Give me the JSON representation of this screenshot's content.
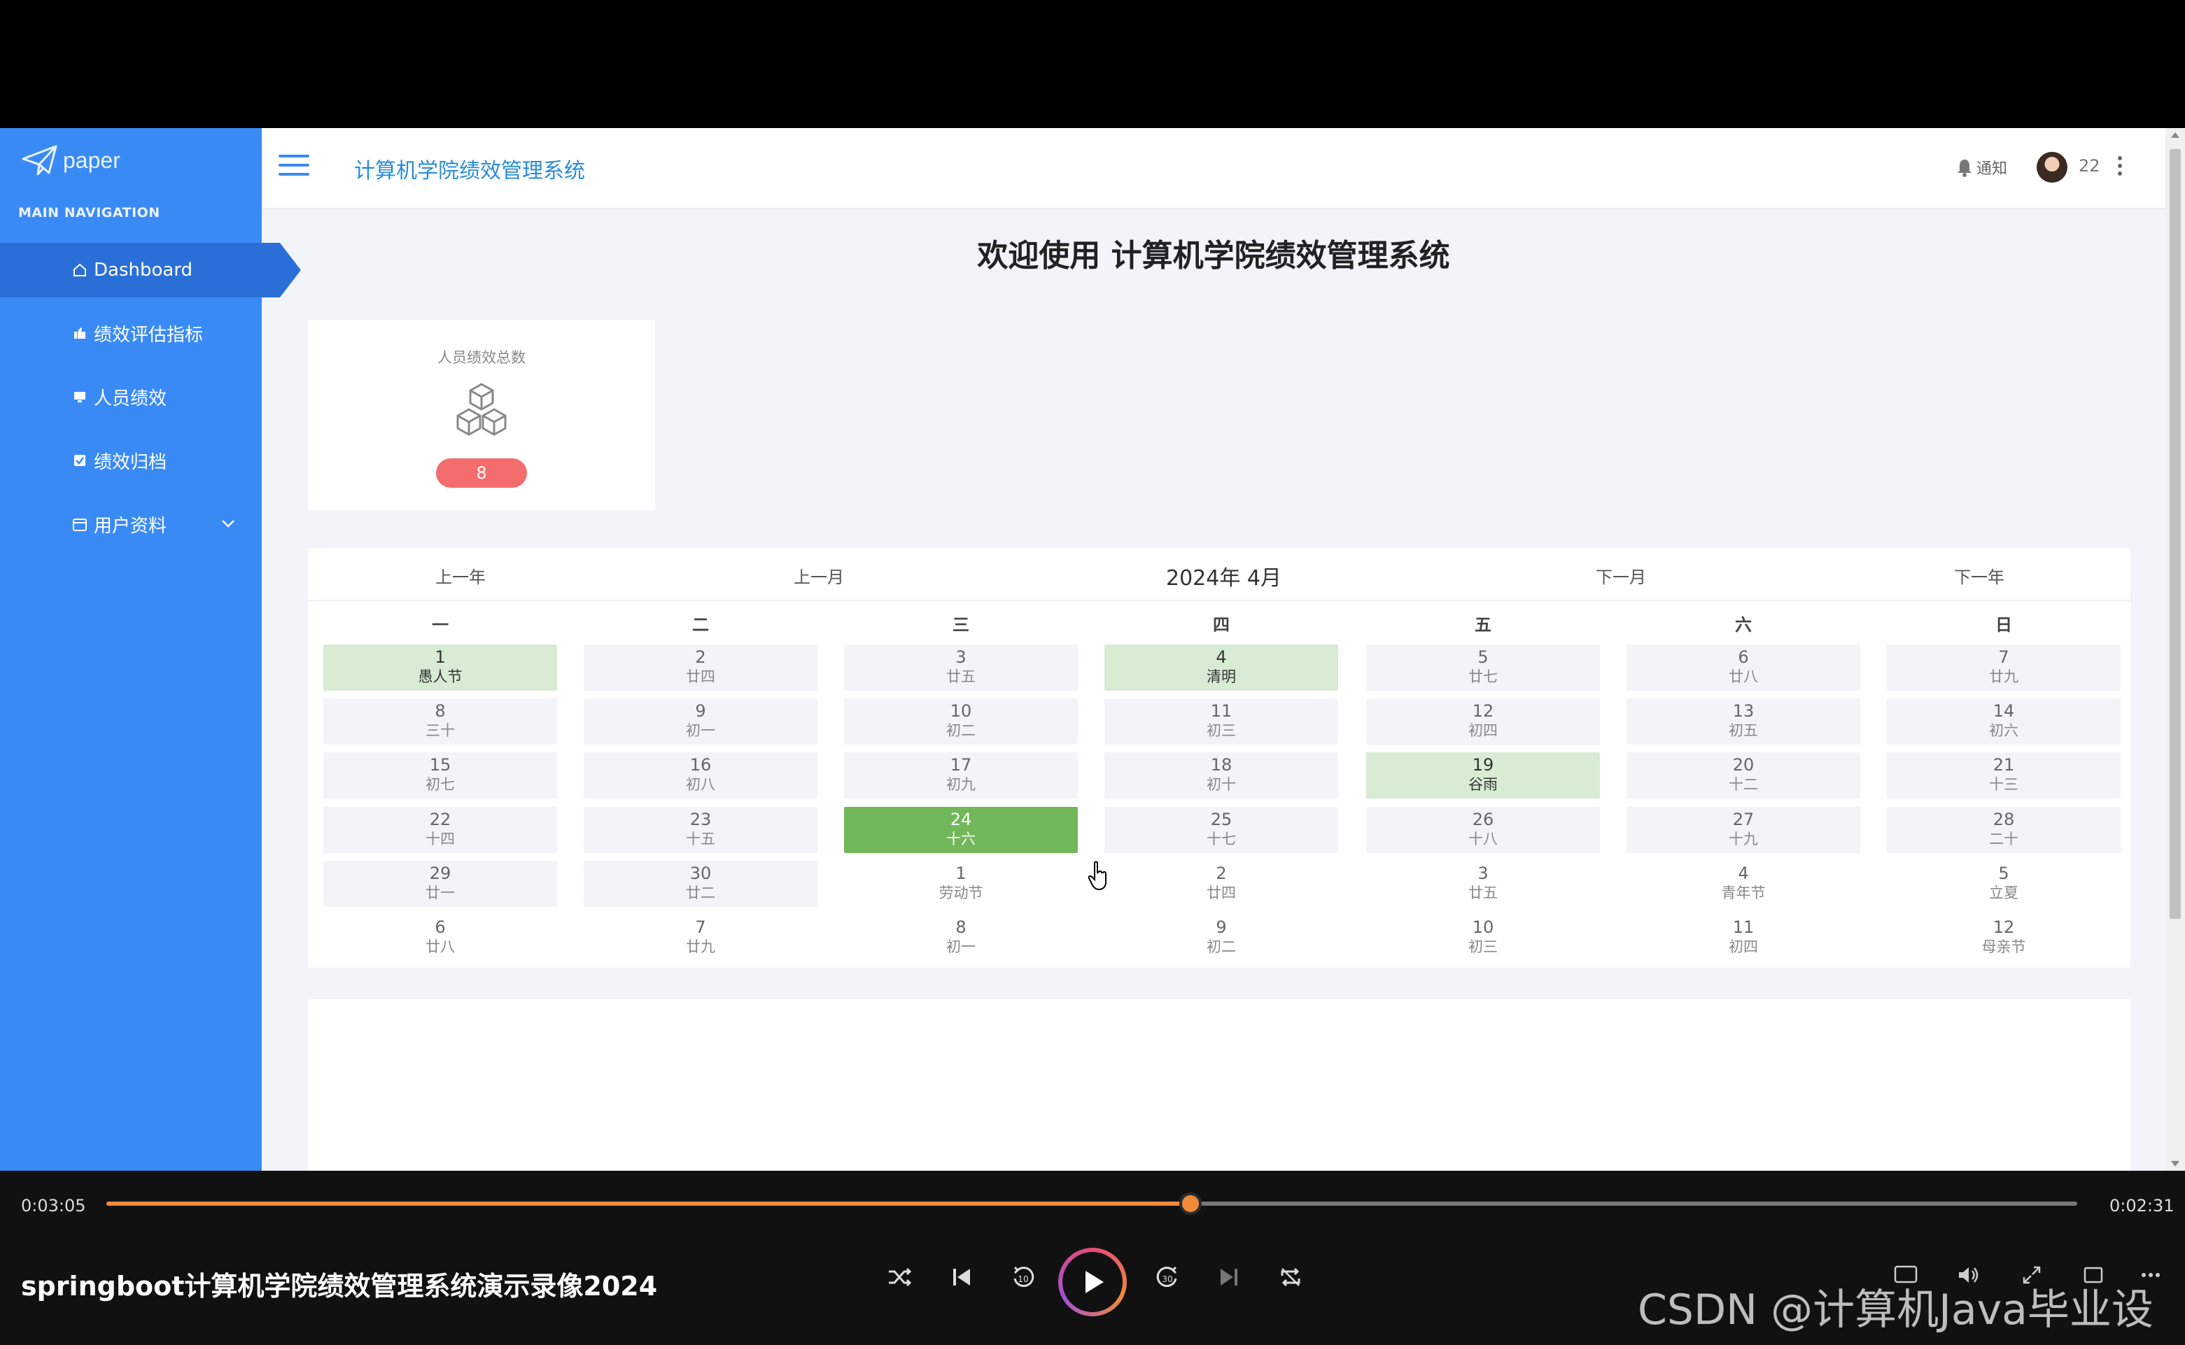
{
  "sidebar": {
    "logo_text": "paper",
    "caption": "MAIN NAVIGATION",
    "items": [
      {
        "label": "Dashboard"
      },
      {
        "label": "绩效评估指标"
      },
      {
        "label": "人员绩效"
      },
      {
        "label": "绩效归档"
      },
      {
        "label": "用户资料"
      }
    ]
  },
  "header": {
    "title": "计算机学院绩效管理系统",
    "notify_label": "通知",
    "user_label": "22"
  },
  "main": {
    "welcome": "欢迎使用 计算机学院绩效管理系统",
    "stat_card": {
      "label": "人员绩效总数",
      "value": "8"
    }
  },
  "calendar": {
    "prev_year": "上一年",
    "prev_month": "上一月",
    "month_title": "2024年 4月",
    "next_month": "下一月",
    "next_year": "下一年",
    "weekdays": [
      "一",
      "二",
      "三",
      "四",
      "五",
      "六",
      "日"
    ],
    "rows": [
      [
        {
          "d": "1",
          "l": "愚人节",
          "t": "holiday"
        },
        {
          "d": "2",
          "l": "廿四",
          "t": "in"
        },
        {
          "d": "3",
          "l": "廿五",
          "t": "in"
        },
        {
          "d": "4",
          "l": "清明",
          "t": "holiday"
        },
        {
          "d": "5",
          "l": "廿七",
          "t": "in"
        },
        {
          "d": "6",
          "l": "廿八",
          "t": "in"
        },
        {
          "d": "7",
          "l": "廿九",
          "t": "in"
        }
      ],
      [
        {
          "d": "8",
          "l": "三十",
          "t": "in"
        },
        {
          "d": "9",
          "l": "初一",
          "t": "in"
        },
        {
          "d": "10",
          "l": "初二",
          "t": "in"
        },
        {
          "d": "11",
          "l": "初三",
          "t": "in"
        },
        {
          "d": "12",
          "l": "初四",
          "t": "in"
        },
        {
          "d": "13",
          "l": "初五",
          "t": "in"
        },
        {
          "d": "14",
          "l": "初六",
          "t": "in"
        }
      ],
      [
        {
          "d": "15",
          "l": "初七",
          "t": "in"
        },
        {
          "d": "16",
          "l": "初八",
          "t": "in"
        },
        {
          "d": "17",
          "l": "初九",
          "t": "in"
        },
        {
          "d": "18",
          "l": "初十",
          "t": "in"
        },
        {
          "d": "19",
          "l": "谷雨",
          "t": "holiday"
        },
        {
          "d": "20",
          "l": "十二",
          "t": "in"
        },
        {
          "d": "21",
          "l": "十三",
          "t": "in"
        }
      ],
      [
        {
          "d": "22",
          "l": "十四",
          "t": "in"
        },
        {
          "d": "23",
          "l": "十五",
          "t": "in"
        },
        {
          "d": "24",
          "l": "十六",
          "t": "today"
        },
        {
          "d": "25",
          "l": "十七",
          "t": "in"
        },
        {
          "d": "26",
          "l": "十八",
          "t": "in"
        },
        {
          "d": "27",
          "l": "十九",
          "t": "in"
        },
        {
          "d": "28",
          "l": "二十",
          "t": "in"
        }
      ],
      [
        {
          "d": "29",
          "l": "廿一",
          "t": "in"
        },
        {
          "d": "30",
          "l": "廿二",
          "t": "in"
        },
        {
          "d": "1",
          "l": "劳动节",
          "t": "out"
        },
        {
          "d": "2",
          "l": "廿四",
          "t": "out"
        },
        {
          "d": "3",
          "l": "廿五",
          "t": "out"
        },
        {
          "d": "4",
          "l": "青年节",
          "t": "out"
        },
        {
          "d": "5",
          "l": "立夏",
          "t": "out"
        }
      ],
      [
        {
          "d": "6",
          "l": "廿八",
          "t": "out"
        },
        {
          "d": "7",
          "l": "廿九",
          "t": "out"
        },
        {
          "d": "8",
          "l": "初一",
          "t": "out"
        },
        {
          "d": "9",
          "l": "初二",
          "t": "out"
        },
        {
          "d": "10",
          "l": "初三",
          "t": "out"
        },
        {
          "d": "11",
          "l": "初四",
          "t": "out"
        },
        {
          "d": "12",
          "l": "母亲节",
          "t": "out"
        }
      ]
    ]
  },
  "player": {
    "elapsed": "0:03:05",
    "total": "0:02:31",
    "progress": 0.55,
    "title": "springboot计算机学院绩效管理系统演示录像2024",
    "rewind_label": "10",
    "forward_label": "30",
    "watermark": "CSDN @计算机Java毕业设计"
  },
  "colors": {
    "sidebar": "#3a8af6",
    "sidebar_active": "#2a6fd8",
    "title_blue": "#2a8cd8",
    "badge_red": "#f56c6c",
    "holiday_green": "#d7ecd2",
    "today_green": "#72b85a",
    "progress_orange": "#f08a3a"
  }
}
